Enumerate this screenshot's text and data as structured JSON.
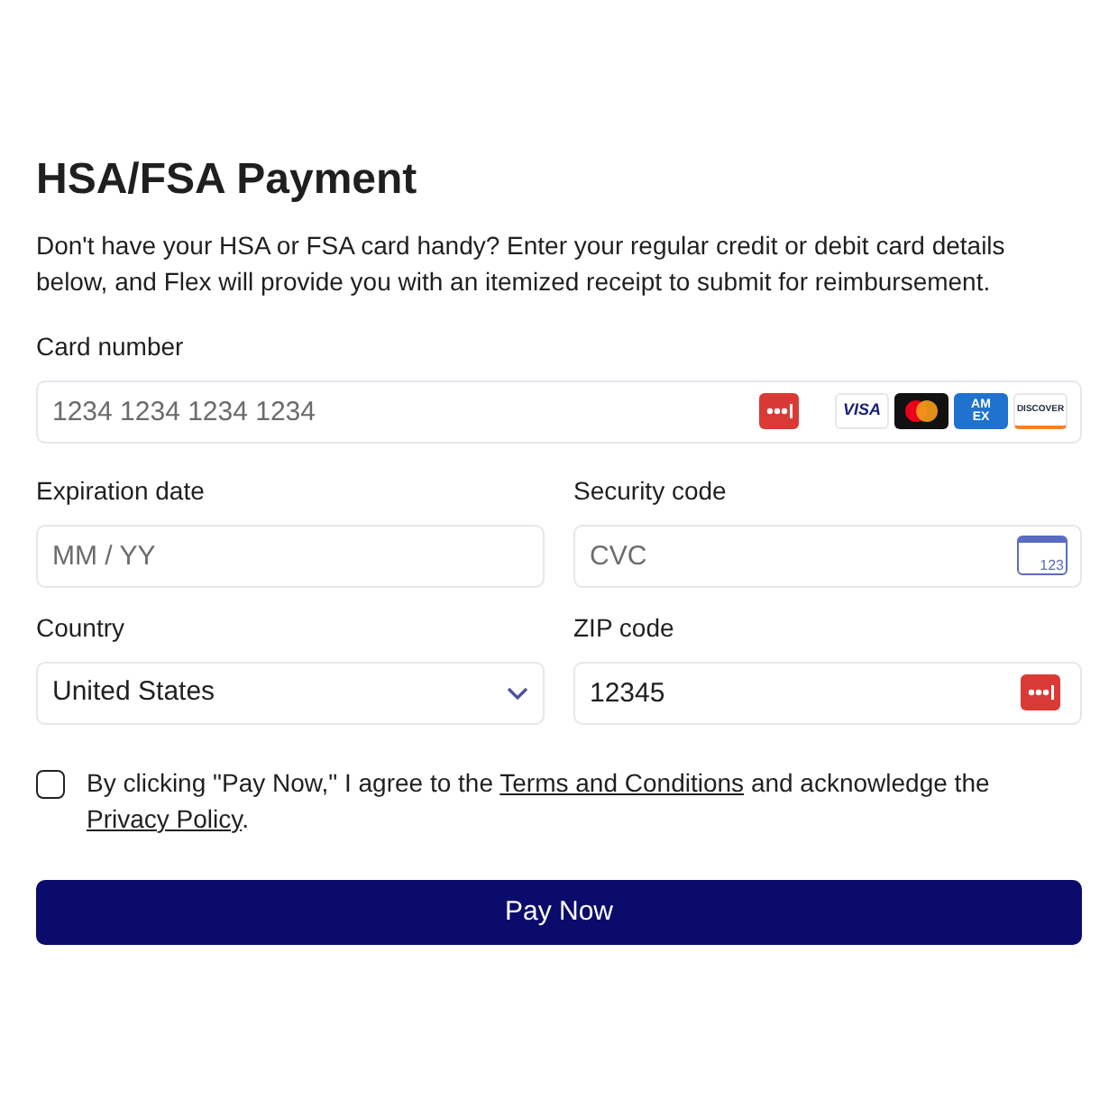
{
  "title": "HSA/FSA Payment",
  "description": "Don't have your HSA or FSA card handy? Enter your regular credit or debit card details below, and Flex will provide you with an itemized receipt to submit for reimbursement.",
  "card_number": {
    "label": "Card number",
    "placeholder": "1234 1234 1234 1234",
    "brands": [
      {
        "kind": "visa",
        "text": "VISA"
      },
      {
        "kind": "mastercard"
      },
      {
        "kind": "amex",
        "text": "AM EX"
      },
      {
        "kind": "discover",
        "text": "DISCOVER"
      }
    ]
  },
  "expiration": {
    "label": "Expiration date",
    "placeholder": "MM / YY"
  },
  "security": {
    "label": "Security code",
    "placeholder": "CVC",
    "icon_text": "123"
  },
  "country": {
    "label": "Country",
    "value": "United States"
  },
  "zip": {
    "label": "ZIP code",
    "value": "12345"
  },
  "consent": {
    "checked": false,
    "before": "By clicking \"Pay Now,\" I agree to the",
    "terms_link": "Terms and Conditions",
    "middle": "and acknowledge the",
    "privacy_link": "Privacy Policy",
    "after": "."
  },
  "submit": "Pay Now"
}
